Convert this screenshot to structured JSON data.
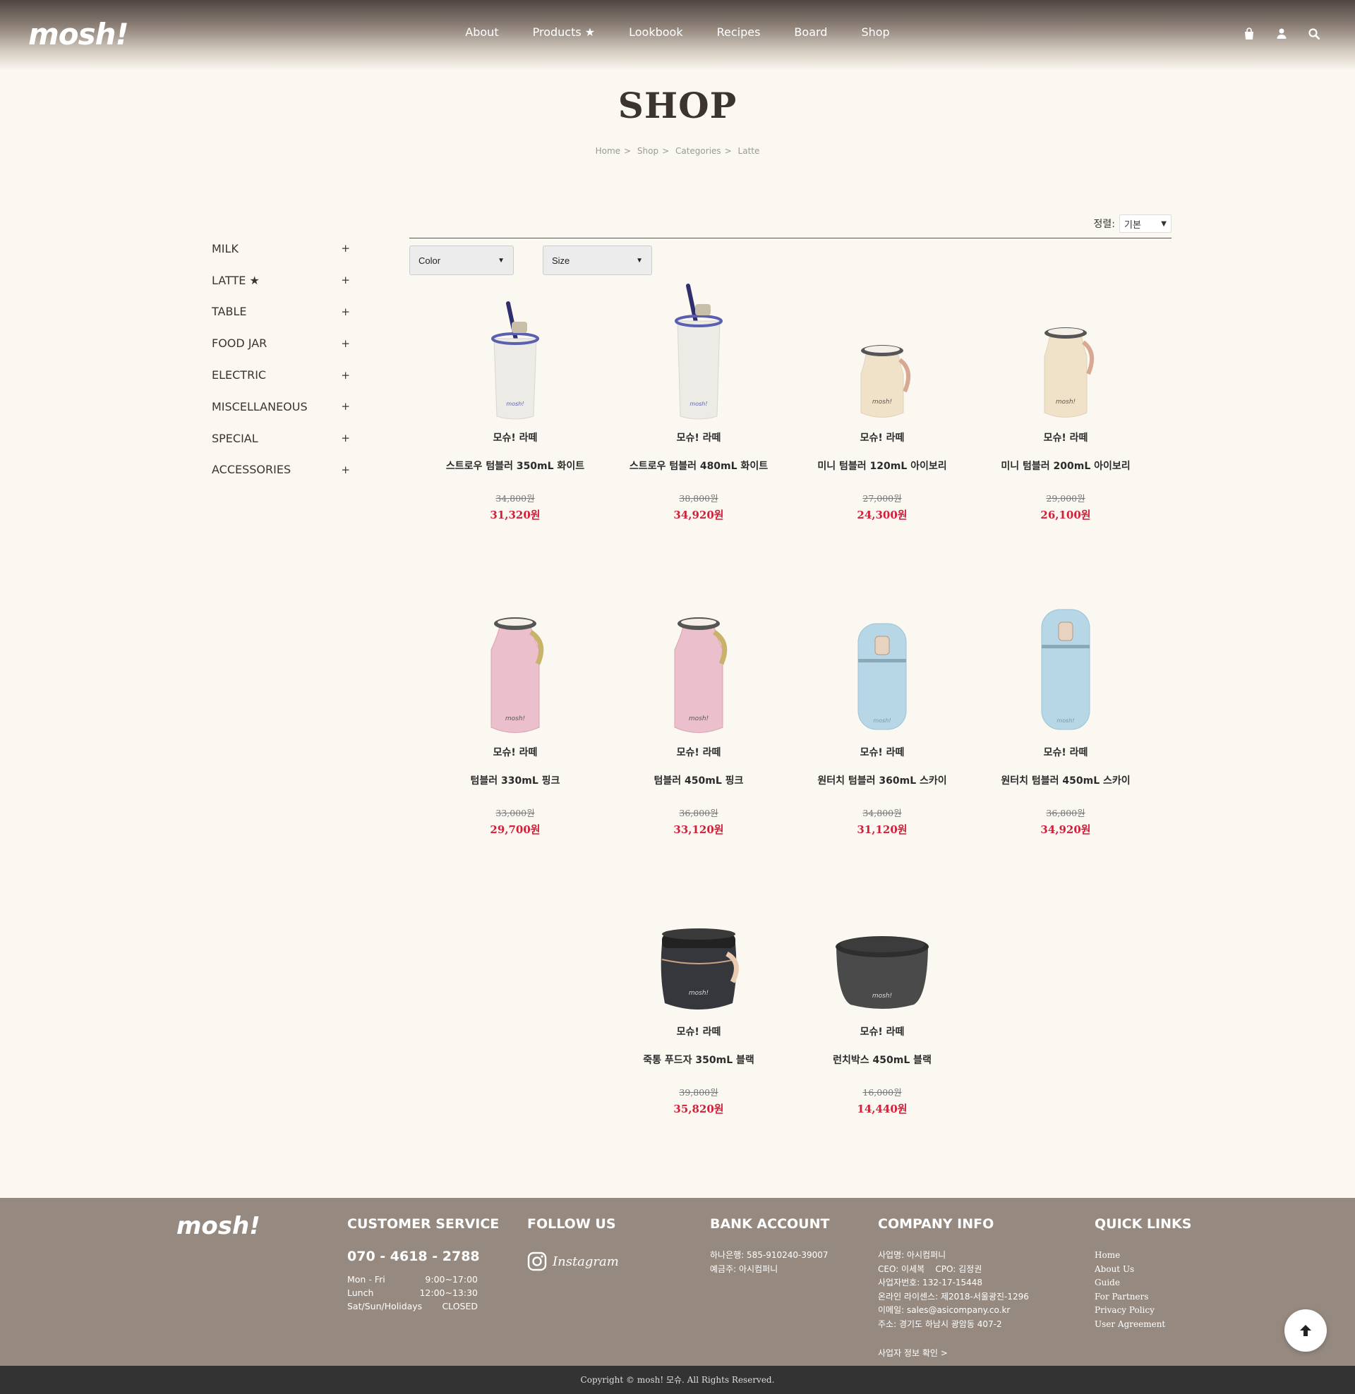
{
  "header": {
    "logo": "mosh!",
    "nav": [
      "About",
      "Products ★",
      "Lookbook",
      "Recipes",
      "Board",
      "Shop"
    ]
  },
  "page": {
    "title": "SHOP",
    "breadcrumb": [
      "Home",
      "Shop",
      "Categories",
      "Latte"
    ]
  },
  "sidebar": {
    "items": [
      "MILK",
      "LATTE ★",
      "TABLE",
      "FOOD JAR",
      "ELECTRIC",
      "MISCELLANEOUS",
      "SPECIAL",
      "ACCESSORIES"
    ],
    "expand_symbol": "+"
  },
  "sort": {
    "label": "정렬:",
    "value": "기본"
  },
  "filters": {
    "color": "Color",
    "size": "Size"
  },
  "products": [
    {
      "brand": "모슈! 라떼",
      "name": "스트로우 텀블러 350mL 화이트",
      "old_price": "34,800원",
      "price": "31,320원",
      "color": "#ecebe6",
      "accent": "#5b5fb0"
    },
    {
      "brand": "모슈! 라떼",
      "name": "스트로우 텀블러 480mL 화이트",
      "old_price": "38,800원",
      "price": "34,920원",
      "color": "#ecebe6",
      "accent": "#5b5fb0"
    },
    {
      "brand": "모슈! 라떼",
      "name": "미니 텀블러 120mL 아이보리",
      "old_price": "27,000원",
      "price": "24,300원",
      "color": "#efe2c8",
      "accent": "#d9a892"
    },
    {
      "brand": "모슈! 라떼",
      "name": "미니 텀블러 200mL 아이보리",
      "old_price": "29,000원",
      "price": "26,100원",
      "color": "#efe2c8",
      "accent": "#d9a892"
    },
    {
      "brand": "모슈! 라떼",
      "name": "텀블러 330mL 핑크",
      "old_price": "33,000원",
      "price": "29,700원",
      "color": "#ebbfcb",
      "accent": "#c9b36a"
    },
    {
      "brand": "모슈! 라떼",
      "name": "텀블러 450mL 핑크",
      "old_price": "36,800원",
      "price": "33,120원",
      "color": "#ebbfcb",
      "accent": "#c9b36a"
    },
    {
      "brand": "모슈! 라떼",
      "name": "원터치 텀블러 360mL 스카이",
      "old_price": "34,800원",
      "price": "31,120원",
      "color": "#b7d7e6",
      "accent": "#e8d3c0"
    },
    {
      "brand": "모슈! 라떼",
      "name": "원터치 텀블러 450mL 스카이",
      "old_price": "36,800원",
      "price": "34,920원",
      "color": "#b7d7e6",
      "accent": "#e8d3c0"
    },
    {
      "brand": "모슈! 라떼",
      "name": "죽통 푸드자 350mL 블랙",
      "old_price": "39,800원",
      "price": "35,820원",
      "color": "#35373d",
      "accent": "#e8cbb0"
    },
    {
      "brand": "모슈! 라떼",
      "name": "런치박스 450mL 블랙",
      "old_price": "16,000원",
      "price": "14,440원",
      "color": "#4a4a4a",
      "accent": "#2e2e2e"
    }
  ],
  "footer": {
    "logo": "mosh!",
    "customer_service": {
      "title": "CUSTOMER SERVICE",
      "phone": "070 - 4618 - 2788",
      "hours": [
        {
          "label": "Mon - Fri",
          "value": "9:00~17:00"
        },
        {
          "label": "Lunch",
          "value": "12:00~13:30"
        },
        {
          "label": "Sat/Sun/Holidays",
          "value": "CLOSED"
        }
      ]
    },
    "follow": {
      "title": "FOLLOW US",
      "instagram": "Instagram"
    },
    "bank": {
      "title": "BANK ACCOUNT",
      "lines": [
        "하나은행: 585-910240-39007",
        "예금주: 아시컴퍼니"
      ]
    },
    "company": {
      "title": "COMPANY INFO",
      "lines": [
        "사업명: 아시컴퍼니",
        "CEO: 이세복    CPO: 김정권",
        "사업자번호: 132-17-15448",
        "온라인 라이센스: 제2018-서울광진-1296",
        "이메일: sales@asicompany.co.kr",
        "주소: 경기도 하남시 광암동 407-2"
      ],
      "link": "사업자 정보 확인 >"
    },
    "quick_links": {
      "title": "QUICK LINKS",
      "items": [
        "Home",
        "About Us",
        "Guide",
        "For Partners",
        "Privacy Policy",
        "User Agreement"
      ]
    },
    "copyright": "Copyright © mosh! 모슈. All Rights Reserved."
  },
  "colors": {
    "sale": "#d0203a",
    "footer_bg": "#968a80",
    "page_bg": "#fbf8f2"
  }
}
